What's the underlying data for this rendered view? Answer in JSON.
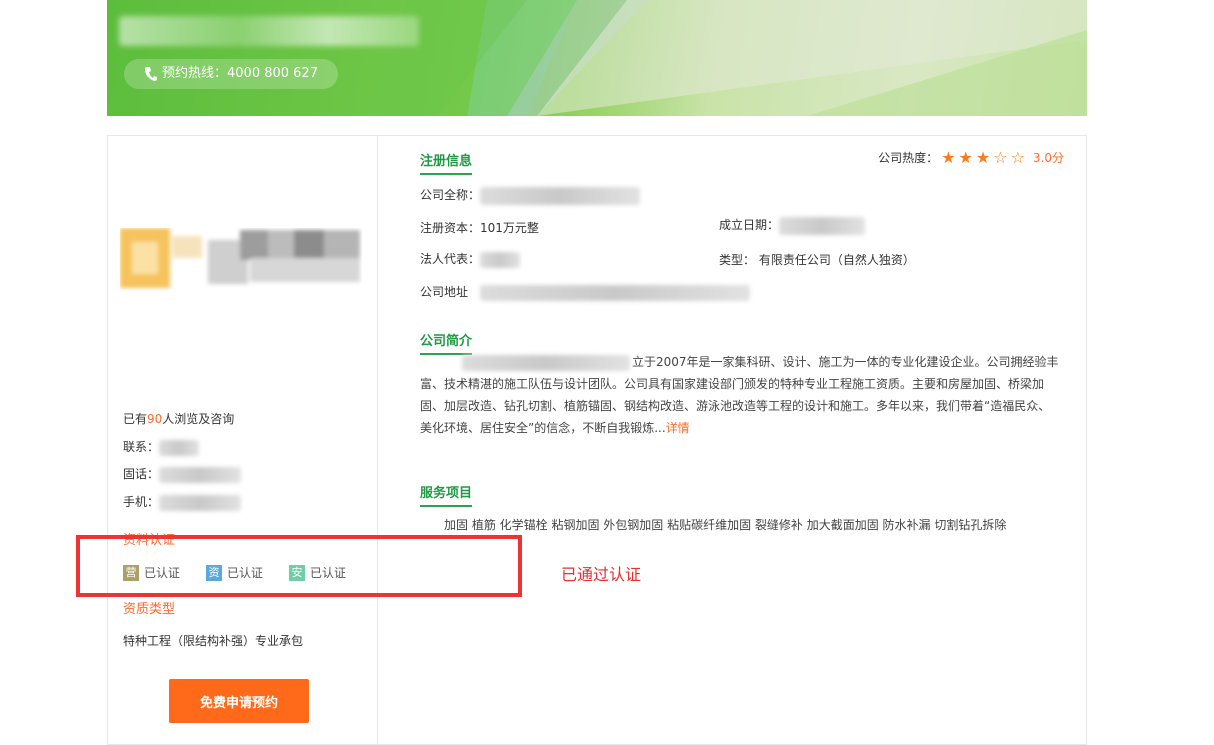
{
  "banner": {
    "hotline_label": "预约热线：4000 800 627"
  },
  "left_panel": {
    "views_prefix": "已有",
    "views_count": "90",
    "views_suffix": "人浏览及咨询",
    "contact_label": "联系：",
    "landline_label": "固话：",
    "mobile_label": "手机：",
    "cert_section_title": "资料认证",
    "certs": [
      {
        "badge": "营",
        "label": "已认证",
        "color": "#a9a06a"
      },
      {
        "badge": "资",
        "label": "已认证",
        "color": "#5aa8dc"
      },
      {
        "badge": "安",
        "label": "已认证",
        "color": "#6dcfa6"
      }
    ],
    "qual_section_title": "资质类型",
    "qual_value": "特种工程（限结构补强）专业承包",
    "apply_button": "免费申请预约"
  },
  "registration": {
    "title": "注册信息",
    "full_name_label": "公司全称：",
    "capital": "注册资本：101万元整",
    "founded_label": "成立日期：",
    "legal_rep_label": "法人代表：",
    "type": "类型： 有限责任公司（自然人独资）",
    "address_label": "公司地址"
  },
  "heat": {
    "label": "公司热度：",
    "rating": 3,
    "max": 5,
    "score": "3.0分"
  },
  "intro": {
    "title": "公司简介",
    "text": "立于2007年是一家集科研、设计、施工为一体的专业化建设企业。公司拥经验丰富、技术精湛的施工队伍与设计团队。公司具有国家建设部门颁发的特种专业工程施工资质。主要和房屋加固、桥梁加固、加层改造、钻孔切割、植筋锚固、钢结构改造、游泳池改造等工程的设计和施工。多年以来，我们带着“造福民众、美化环境、居住安全”的信念，不断自我锻炼...",
    "more": "详情"
  },
  "services": {
    "title": "服务项目",
    "items": "加固 植筋 化学锚栓 粘钢加固 外包钢加固 粘贴碳纤维加固 裂缝修补 加大截面加固 防水补漏 切割钻孔拆除"
  },
  "annotation": {
    "text": "已通过认证",
    "color": "#e53030"
  }
}
